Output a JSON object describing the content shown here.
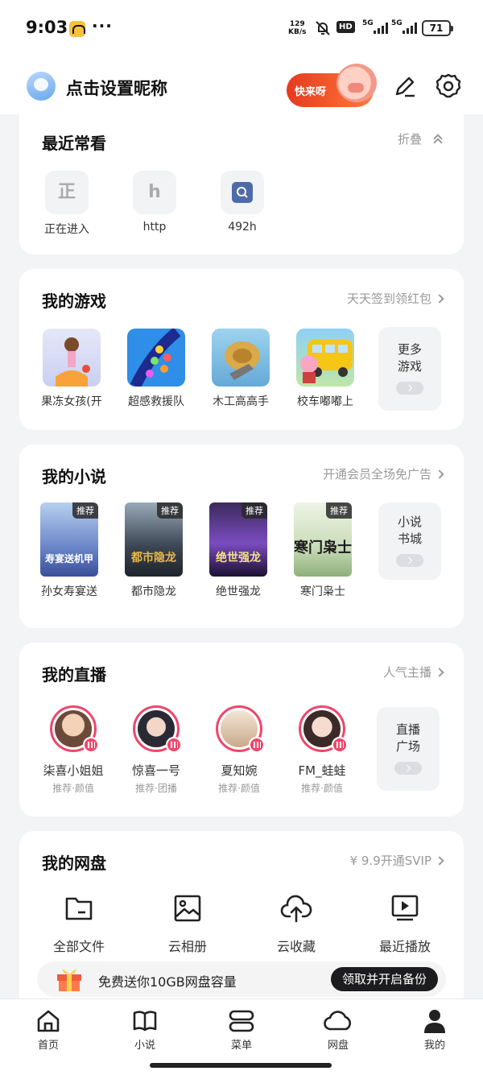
{
  "status_bar": {
    "time": "9:03",
    "dots": "···",
    "speed_value": "129",
    "speed_unit": "KB/s",
    "hd_label": "HD",
    "network_1": "5G",
    "network_2": "5G",
    "battery": "71"
  },
  "header": {
    "nickname": "点击设置昵称",
    "promo_label": "快来呀"
  },
  "recent": {
    "title": "最近常看",
    "fold_label": "折叠",
    "items": [
      {
        "icon_text": "正",
        "label": "正在进入"
      },
      {
        "icon_text": "h",
        "label": "http"
      },
      {
        "icon_text": "",
        "label": "492h"
      }
    ]
  },
  "games": {
    "title": "我的游戏",
    "link": "天天签到领红包",
    "items": [
      {
        "label": "果冻女孩(开"
      },
      {
        "label": "超感救援队"
      },
      {
        "label": "木工高高手"
      },
      {
        "label": "校车嘟嘟上"
      }
    ],
    "more_label": "更多游戏"
  },
  "novels": {
    "title": "我的小说",
    "link": "开通会员全场免广告",
    "tag": "推荐",
    "items": [
      {
        "label": "孙女寿宴送",
        "cover_text": "寿宴送机甲"
      },
      {
        "label": "都市隐龙",
        "cover_text": "都市隐龙"
      },
      {
        "label": "绝世强龙",
        "cover_text": "绝世强龙"
      },
      {
        "label": "寒门枭士",
        "cover_text": "寒门枭士"
      }
    ],
    "more_label": "小说书城"
  },
  "live": {
    "title": "我的直播",
    "link": "人气主播",
    "items": [
      {
        "name": "柒喜小姐姐",
        "sub": "推荐·颜值"
      },
      {
        "name": "惊喜一号",
        "sub": "推荐·团播"
      },
      {
        "name": "夏知婉",
        "sub": "推荐·颜值"
      },
      {
        "name": "FM_蛙蛙",
        "sub": "推荐·颜值"
      }
    ],
    "more_label": "直播广场"
  },
  "netdisk": {
    "title": "我的网盘",
    "link": "¥ 9.9开通SVIP",
    "items": [
      {
        "label": "全部文件",
        "icon": "folder-icon"
      },
      {
        "label": "云相册",
        "icon": "image-icon"
      },
      {
        "label": "云收藏",
        "icon": "cloud-upload-icon"
      },
      {
        "label": "最近播放",
        "icon": "play-screen-icon"
      }
    ],
    "banner_text": "免费送你10GB网盘容量",
    "banner_button": "领取并开启备份"
  },
  "tabbar": {
    "items": [
      {
        "label": "首页",
        "icon": "home-icon"
      },
      {
        "label": "小说",
        "icon": "book-icon"
      },
      {
        "label": "菜单",
        "icon": "menu-icon"
      },
      {
        "label": "网盘",
        "icon": "cloud-icon"
      },
      {
        "label": "我的",
        "icon": "person-icon"
      }
    ]
  },
  "colors": {
    "accent_live": "#f0466a",
    "promo": "#e53a1f",
    "background": "#f3f4f6"
  }
}
